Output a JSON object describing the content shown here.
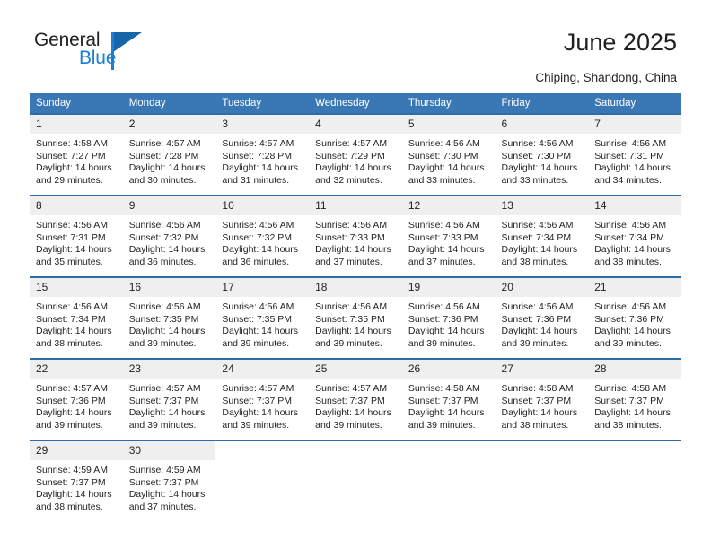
{
  "brand": {
    "name_part1": "General",
    "name_part2": "Blue"
  },
  "header": {
    "title": "June 2025",
    "location": "Chiping, Shandong, China"
  },
  "calendar": {
    "weekday_headers": [
      "Sunday",
      "Monday",
      "Tuesday",
      "Wednesday",
      "Thursday",
      "Friday",
      "Saturday"
    ],
    "labels": {
      "sunrise": "Sunrise:",
      "sunset": "Sunset:",
      "daylight": "Daylight:"
    },
    "colors": {
      "header_blue": "#3a77b5",
      "row_border_blue": "#2d6ca8",
      "daynum_background": "#efefef",
      "logo_blue": "#1a7fd4",
      "logo_dark_blue": "#1565a8",
      "text": "#231f20"
    },
    "weeks": [
      [
        {
          "day": "1",
          "sunrise": "Sunrise: 4:58 AM",
          "sunset": "Sunset: 7:27 PM",
          "daylight_1": "Daylight: 14 hours",
          "daylight_2": "and 29 minutes."
        },
        {
          "day": "2",
          "sunrise": "Sunrise: 4:57 AM",
          "sunset": "Sunset: 7:28 PM",
          "daylight_1": "Daylight: 14 hours",
          "daylight_2": "and 30 minutes."
        },
        {
          "day": "3",
          "sunrise": "Sunrise: 4:57 AM",
          "sunset": "Sunset: 7:28 PM",
          "daylight_1": "Daylight: 14 hours",
          "daylight_2": "and 31 minutes."
        },
        {
          "day": "4",
          "sunrise": "Sunrise: 4:57 AM",
          "sunset": "Sunset: 7:29 PM",
          "daylight_1": "Daylight: 14 hours",
          "daylight_2": "and 32 minutes."
        },
        {
          "day": "5",
          "sunrise": "Sunrise: 4:56 AM",
          "sunset": "Sunset: 7:30 PM",
          "daylight_1": "Daylight: 14 hours",
          "daylight_2": "and 33 minutes."
        },
        {
          "day": "6",
          "sunrise": "Sunrise: 4:56 AM",
          "sunset": "Sunset: 7:30 PM",
          "daylight_1": "Daylight: 14 hours",
          "daylight_2": "and 33 minutes."
        },
        {
          "day": "7",
          "sunrise": "Sunrise: 4:56 AM",
          "sunset": "Sunset: 7:31 PM",
          "daylight_1": "Daylight: 14 hours",
          "daylight_2": "and 34 minutes."
        }
      ],
      [
        {
          "day": "8",
          "sunrise": "Sunrise: 4:56 AM",
          "sunset": "Sunset: 7:31 PM",
          "daylight_1": "Daylight: 14 hours",
          "daylight_2": "and 35 minutes."
        },
        {
          "day": "9",
          "sunrise": "Sunrise: 4:56 AM",
          "sunset": "Sunset: 7:32 PM",
          "daylight_1": "Daylight: 14 hours",
          "daylight_2": "and 36 minutes."
        },
        {
          "day": "10",
          "sunrise": "Sunrise: 4:56 AM",
          "sunset": "Sunset: 7:32 PM",
          "daylight_1": "Daylight: 14 hours",
          "daylight_2": "and 36 minutes."
        },
        {
          "day": "11",
          "sunrise": "Sunrise: 4:56 AM",
          "sunset": "Sunset: 7:33 PM",
          "daylight_1": "Daylight: 14 hours",
          "daylight_2": "and 37 minutes."
        },
        {
          "day": "12",
          "sunrise": "Sunrise: 4:56 AM",
          "sunset": "Sunset: 7:33 PM",
          "daylight_1": "Daylight: 14 hours",
          "daylight_2": "and 37 minutes."
        },
        {
          "day": "13",
          "sunrise": "Sunrise: 4:56 AM",
          "sunset": "Sunset: 7:34 PM",
          "daylight_1": "Daylight: 14 hours",
          "daylight_2": "and 38 minutes."
        },
        {
          "day": "14",
          "sunrise": "Sunrise: 4:56 AM",
          "sunset": "Sunset: 7:34 PM",
          "daylight_1": "Daylight: 14 hours",
          "daylight_2": "and 38 minutes."
        }
      ],
      [
        {
          "day": "15",
          "sunrise": "Sunrise: 4:56 AM",
          "sunset": "Sunset: 7:34 PM",
          "daylight_1": "Daylight: 14 hours",
          "daylight_2": "and 38 minutes."
        },
        {
          "day": "16",
          "sunrise": "Sunrise: 4:56 AM",
          "sunset": "Sunset: 7:35 PM",
          "daylight_1": "Daylight: 14 hours",
          "daylight_2": "and 39 minutes."
        },
        {
          "day": "17",
          "sunrise": "Sunrise: 4:56 AM",
          "sunset": "Sunset: 7:35 PM",
          "daylight_1": "Daylight: 14 hours",
          "daylight_2": "and 39 minutes."
        },
        {
          "day": "18",
          "sunrise": "Sunrise: 4:56 AM",
          "sunset": "Sunset: 7:35 PM",
          "daylight_1": "Daylight: 14 hours",
          "daylight_2": "and 39 minutes."
        },
        {
          "day": "19",
          "sunrise": "Sunrise: 4:56 AM",
          "sunset": "Sunset: 7:36 PM",
          "daylight_1": "Daylight: 14 hours",
          "daylight_2": "and 39 minutes."
        },
        {
          "day": "20",
          "sunrise": "Sunrise: 4:56 AM",
          "sunset": "Sunset: 7:36 PM",
          "daylight_1": "Daylight: 14 hours",
          "daylight_2": "and 39 minutes."
        },
        {
          "day": "21",
          "sunrise": "Sunrise: 4:56 AM",
          "sunset": "Sunset: 7:36 PM",
          "daylight_1": "Daylight: 14 hours",
          "daylight_2": "and 39 minutes."
        }
      ],
      [
        {
          "day": "22",
          "sunrise": "Sunrise: 4:57 AM",
          "sunset": "Sunset: 7:36 PM",
          "daylight_1": "Daylight: 14 hours",
          "daylight_2": "and 39 minutes."
        },
        {
          "day": "23",
          "sunrise": "Sunrise: 4:57 AM",
          "sunset": "Sunset: 7:37 PM",
          "daylight_1": "Daylight: 14 hours",
          "daylight_2": "and 39 minutes."
        },
        {
          "day": "24",
          "sunrise": "Sunrise: 4:57 AM",
          "sunset": "Sunset: 7:37 PM",
          "daylight_1": "Daylight: 14 hours",
          "daylight_2": "and 39 minutes."
        },
        {
          "day": "25",
          "sunrise": "Sunrise: 4:57 AM",
          "sunset": "Sunset: 7:37 PM",
          "daylight_1": "Daylight: 14 hours",
          "daylight_2": "and 39 minutes."
        },
        {
          "day": "26",
          "sunrise": "Sunrise: 4:58 AM",
          "sunset": "Sunset: 7:37 PM",
          "daylight_1": "Daylight: 14 hours",
          "daylight_2": "and 39 minutes."
        },
        {
          "day": "27",
          "sunrise": "Sunrise: 4:58 AM",
          "sunset": "Sunset: 7:37 PM",
          "daylight_1": "Daylight: 14 hours",
          "daylight_2": "and 38 minutes."
        },
        {
          "day": "28",
          "sunrise": "Sunrise: 4:58 AM",
          "sunset": "Sunset: 7:37 PM",
          "daylight_1": "Daylight: 14 hours",
          "daylight_2": "and 38 minutes."
        }
      ],
      [
        {
          "day": "29",
          "sunrise": "Sunrise: 4:59 AM",
          "sunset": "Sunset: 7:37 PM",
          "daylight_1": "Daylight: 14 hours",
          "daylight_2": "and 38 minutes."
        },
        {
          "day": "30",
          "sunrise": "Sunrise: 4:59 AM",
          "sunset": "Sunset: 7:37 PM",
          "daylight_1": "Daylight: 14 hours",
          "daylight_2": "and 37 minutes."
        },
        {
          "day": "",
          "sunrise": "",
          "sunset": "",
          "daylight_1": "",
          "daylight_2": "",
          "blank": true
        },
        {
          "day": "",
          "sunrise": "",
          "sunset": "",
          "daylight_1": "",
          "daylight_2": "",
          "blank": true
        },
        {
          "day": "",
          "sunrise": "",
          "sunset": "",
          "daylight_1": "",
          "daylight_2": "",
          "blank": true
        },
        {
          "day": "",
          "sunrise": "",
          "sunset": "",
          "daylight_1": "",
          "daylight_2": "",
          "blank": true
        },
        {
          "day": "",
          "sunrise": "",
          "sunset": "",
          "daylight_1": "",
          "daylight_2": "",
          "blank": true
        }
      ]
    ]
  }
}
